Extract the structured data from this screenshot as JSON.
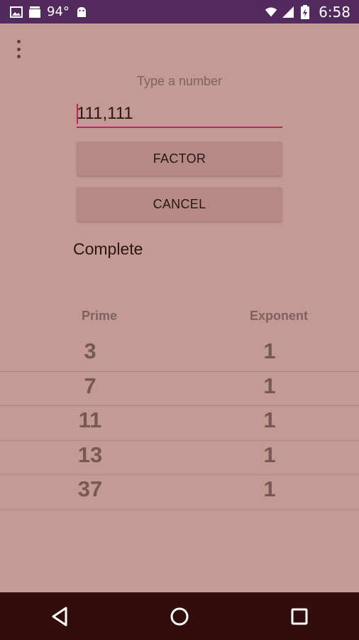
{
  "status_bar": {
    "temperature": "94°",
    "time": "6:58",
    "icons": [
      "image-icon",
      "news-icon",
      "temperature-text",
      "android-icon",
      "wifi-icon",
      "signal-icon",
      "battery-icon"
    ]
  },
  "menu": {
    "icon": "more-vert-icon"
  },
  "form": {
    "hint": "Type a number",
    "input_value": "111,111",
    "factor_label": "FACTOR",
    "cancel_label": "CANCEL"
  },
  "status_text": "Complete",
  "table": {
    "headers": {
      "prime": "Prime",
      "exponent": "Exponent"
    },
    "rows": [
      {
        "prime": "3",
        "exponent": "1"
      },
      {
        "prime": "7",
        "exponent": "1"
      },
      {
        "prime": "11",
        "exponent": "1"
      },
      {
        "prime": "13",
        "exponent": "1"
      },
      {
        "prime": "37",
        "exponent": "1"
      }
    ]
  },
  "nav_bar": {
    "icons": [
      "back-icon",
      "home-icon",
      "recents-icon"
    ]
  },
  "colors": {
    "background": "#c39a94",
    "status_bar": "#532a5e",
    "nav_bar": "#330d0b",
    "accent": "#c2245a"
  }
}
